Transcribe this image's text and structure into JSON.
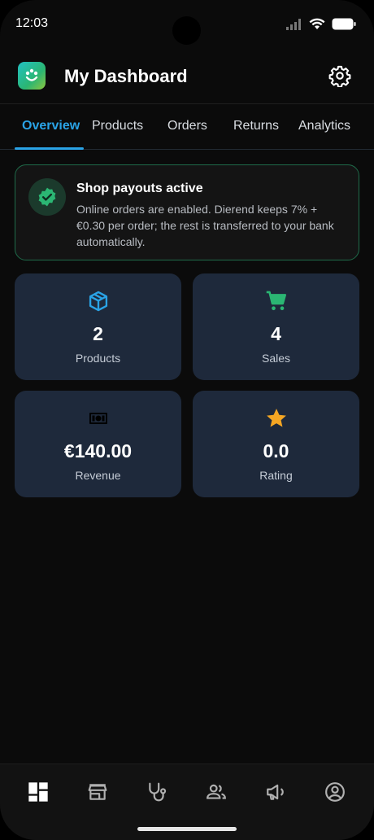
{
  "status_bar": {
    "time": "12:03"
  },
  "app": {
    "title": "My Dashboard"
  },
  "tabs": [
    {
      "label": "Overview",
      "active": true
    },
    {
      "label": "Products",
      "active": false
    },
    {
      "label": "Orders",
      "active": false
    },
    {
      "label": "Returns",
      "active": false
    },
    {
      "label": "Analytics",
      "active": false
    }
  ],
  "banner": {
    "title": "Shop payouts active",
    "text": "Online orders are enabled. Dierend keeps 7% + €0.30 per order; the rest is transferred to your bank automatically.",
    "icon": "verified-badge-icon",
    "accent_color": "#2bb673"
  },
  "stats": [
    {
      "icon": "box-icon",
      "value": "2",
      "label": "Products",
      "icon_color": "#2aa3e6"
    },
    {
      "icon": "cart-icon",
      "value": "4",
      "label": "Sales",
      "icon_color": "#2bb673"
    },
    {
      "icon": "cash-icon",
      "value": "€140.00",
      "label": "Revenue",
      "icon_color": "#000000"
    },
    {
      "icon": "star-icon",
      "value": "0.0",
      "label": "Rating",
      "icon_color": "#f5a623"
    }
  ],
  "bottom_nav": [
    {
      "icon": "dashboard-icon",
      "active": true
    },
    {
      "icon": "store-icon",
      "active": false
    },
    {
      "icon": "stethoscope-icon",
      "active": false
    },
    {
      "icon": "people-icon",
      "active": false
    },
    {
      "icon": "megaphone-icon",
      "active": false
    },
    {
      "icon": "account-icon",
      "active": false
    }
  ],
  "colors": {
    "accent": "#2aa3e6",
    "success": "#2bb673",
    "card_bg": "#1e293b",
    "background": "#0b0b0b"
  }
}
